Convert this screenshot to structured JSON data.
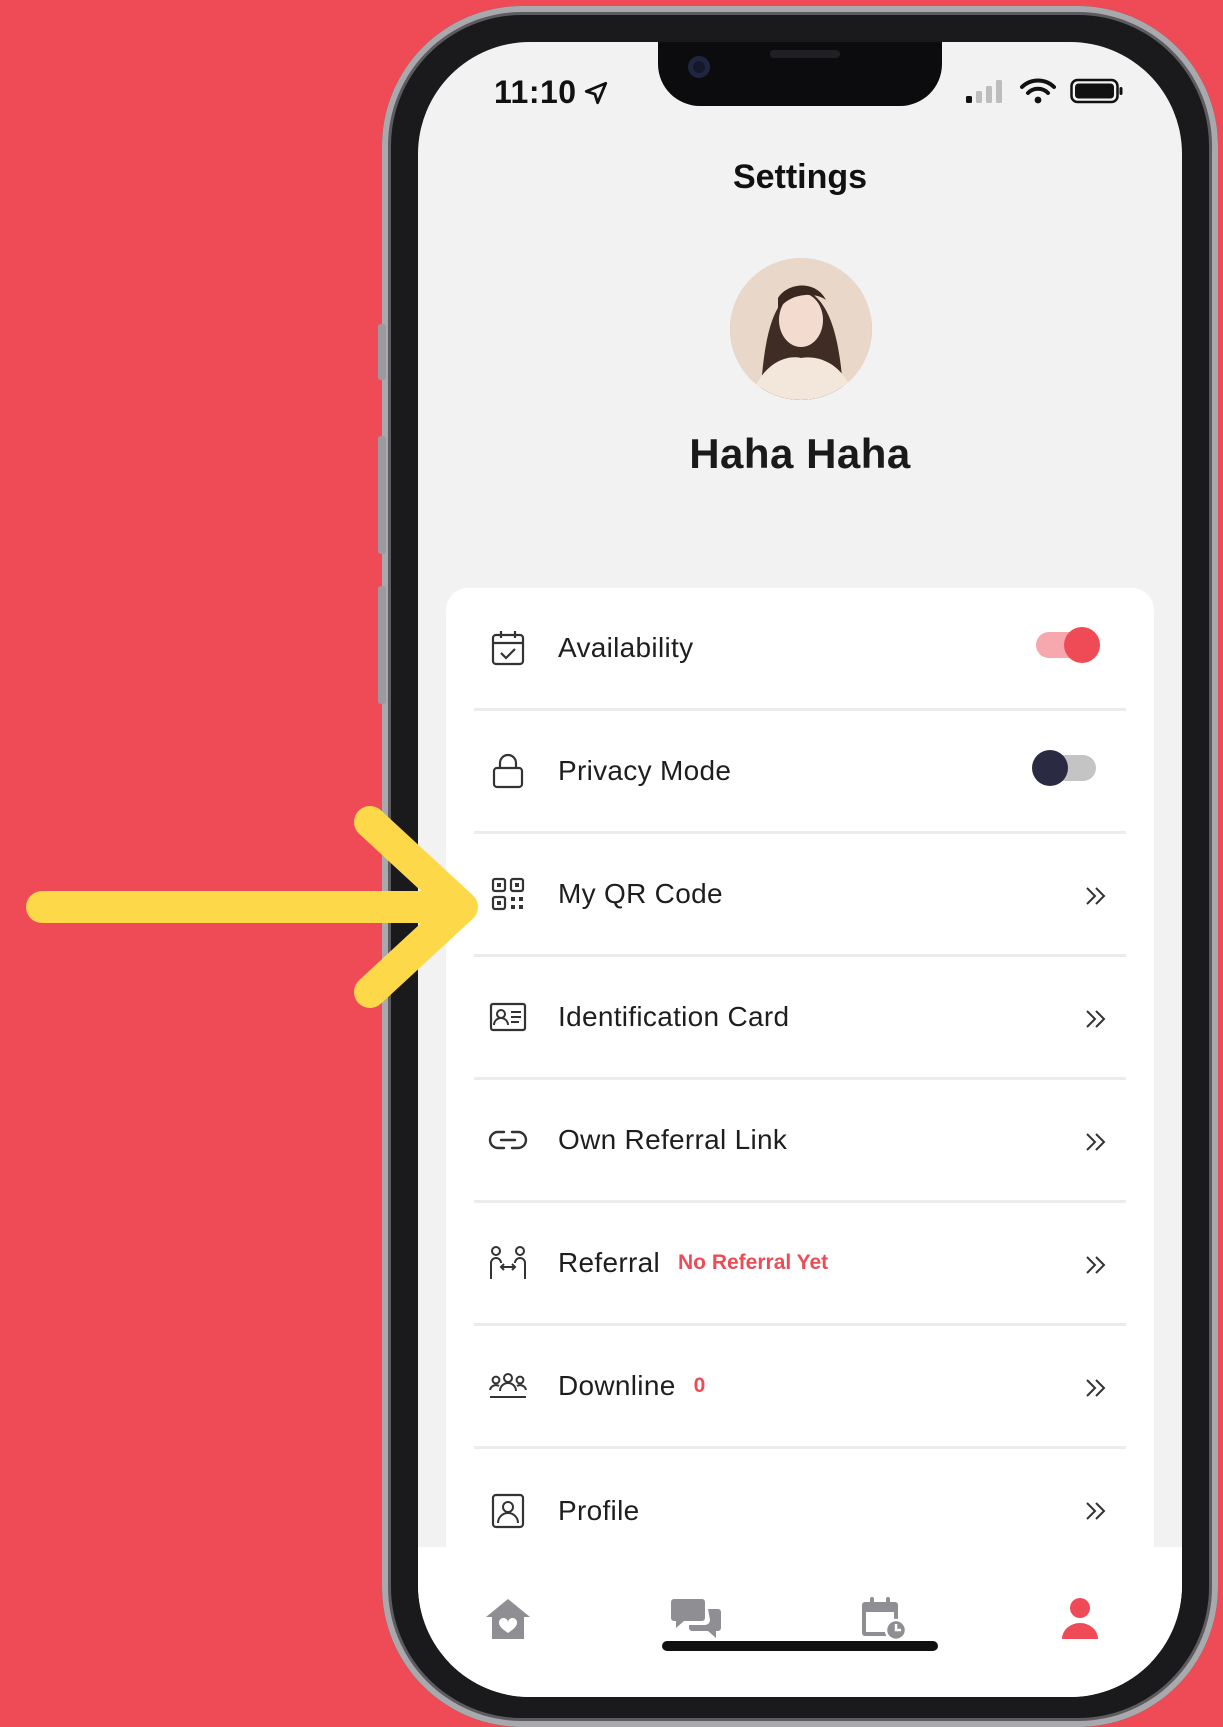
{
  "status_bar": {
    "time": "11:10"
  },
  "header": {
    "title": "Settings"
  },
  "profile": {
    "name": "Haha Haha"
  },
  "settings": {
    "availability": {
      "label": "Availability",
      "enabled": true
    },
    "privacy_mode": {
      "label": "Privacy Mode",
      "enabled": false
    },
    "qr_code": {
      "label": "My QR Code"
    },
    "id_card": {
      "label": "Identification Card"
    },
    "own_referral_link": {
      "label": "Own Referral Link"
    },
    "referral": {
      "label": "Referral",
      "badge": "No Referral Yet"
    },
    "downline": {
      "label": "Downline",
      "badge": "0"
    },
    "profile": {
      "label": "Profile"
    }
  },
  "tabbar": {
    "active": "profile-tab",
    "tabs": [
      "home-icon",
      "chat-icon",
      "calendar-clock-icon",
      "person-icon"
    ]
  },
  "colors": {
    "background": "#ef4b56",
    "accent": "#ef4b56",
    "arrow": "#fdd94a",
    "toggle_off_knob": "#2a2b42"
  }
}
